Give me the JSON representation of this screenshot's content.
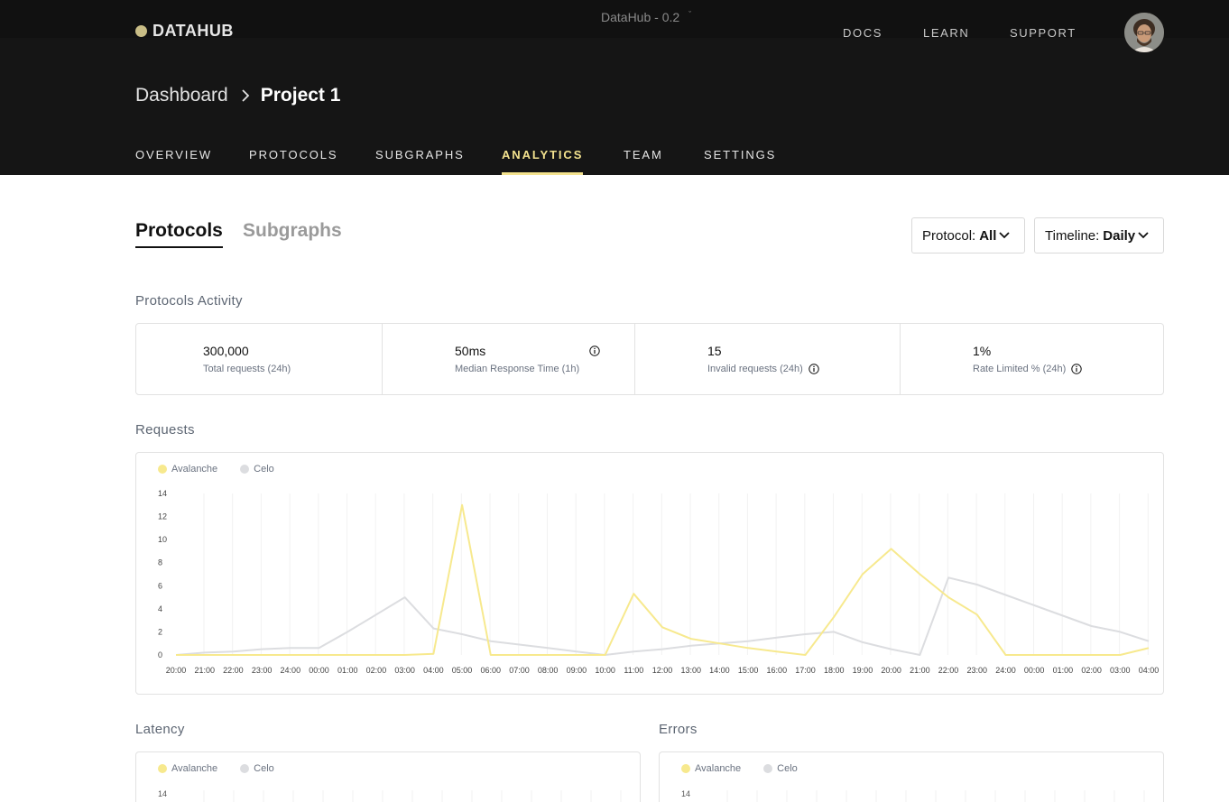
{
  "app": {
    "logo_text": "DATAHUB",
    "version_label": "DataHub - 0.2",
    "top_nav": [
      "DOCS",
      "LEARN",
      "SUPPORT"
    ]
  },
  "breadcrumb": {
    "parent": "Dashboard",
    "current": "Project 1"
  },
  "main_nav": {
    "items": [
      "OVERVIEW",
      "PROTOCOLS",
      "SUBGRAPHS",
      "ANALYTICS",
      "TEAM",
      "SETTINGS"
    ],
    "active": "ANALYTICS"
  },
  "sub_tabs": {
    "protocols": "Protocols",
    "subgraphs": "Subgraphs",
    "active": "Protocols"
  },
  "filters": {
    "protocol": {
      "label": "Protocol:",
      "value": "All"
    },
    "timeline": {
      "label": "Timeline:",
      "value": "Daily"
    }
  },
  "activity": {
    "title": "Protocols Activity",
    "stats": [
      {
        "value": "300,000",
        "label": "Total requests (24h)",
        "info": false
      },
      {
        "value": "50ms",
        "label": "Median Response Time (1h)",
        "info": true
      },
      {
        "value": "15",
        "label": "Invalid requests (24h)",
        "info": true
      },
      {
        "value": "1%",
        "label": "Rate Limited % (24h)",
        "info": true
      }
    ]
  },
  "colors": {
    "avalanche": "#f7e98e",
    "celo": "#dcdde0",
    "accent": "#f3e28e"
  },
  "requests": {
    "title": "Requests",
    "legend": [
      "Avalanche",
      "Celo"
    ]
  },
  "latency": {
    "title": "Latency",
    "legend": [
      "Avalanche",
      "Celo"
    ],
    "first_tick": "14"
  },
  "errors": {
    "title": "Errors",
    "legend": [
      "Avalanche",
      "Celo"
    ],
    "first_tick": "14"
  },
  "chart_data": {
    "type": "line",
    "title": "Requests",
    "xlabel": "",
    "ylabel": "",
    "ylim": [
      0,
      14
    ],
    "yticks": [
      "0",
      "2",
      "4",
      "6",
      "8",
      "10",
      "12",
      "14"
    ],
    "grid": "vertical",
    "legend_position": "top-left",
    "categories": [
      "20:00",
      "21:00",
      "22:00",
      "23:00",
      "24:00",
      "00:00",
      "01:00",
      "02:00",
      "03:00",
      "04:00",
      "05:00",
      "06:00",
      "07:00",
      "08:00",
      "09:00",
      "10:00",
      "11:00",
      "12:00",
      "13:00",
      "14:00",
      "15:00",
      "16:00",
      "17:00",
      "18:00",
      "19:00",
      "20:00",
      "21:00",
      "22:00",
      "23:00",
      "24:00",
      "00:00",
      "01:00",
      "02:00",
      "03:00",
      "04:00"
    ],
    "series": [
      {
        "name": "Avalanche",
        "color": "#f7e98e",
        "values": [
          0,
          0,
          0,
          0,
          0,
          0,
          0,
          0,
          0,
          0.1,
          13,
          0,
          0,
          0,
          0,
          0,
          5.3,
          2.4,
          1.4,
          1.0,
          0.6,
          0.3,
          0,
          3.3,
          7.0,
          9.2,
          7.0,
          5.0,
          3.5,
          0,
          0,
          0,
          0,
          0,
          0.6
        ]
      },
      {
        "name": "Celo",
        "color": "#dcdde0",
        "values": [
          0,
          0.2,
          0.3,
          0.5,
          0.6,
          0.6,
          2.0,
          3.5,
          5.0,
          2.3,
          1.8,
          1.2,
          0.9,
          0.6,
          0.3,
          0,
          0.3,
          0.5,
          0.8,
          1.0,
          1.2,
          1.5,
          1.8,
          2.0,
          1.1,
          0.5,
          0,
          6.7,
          6.1,
          5.2,
          4.3,
          3.4,
          2.5,
          2.0,
          1.2
        ]
      }
    ]
  }
}
